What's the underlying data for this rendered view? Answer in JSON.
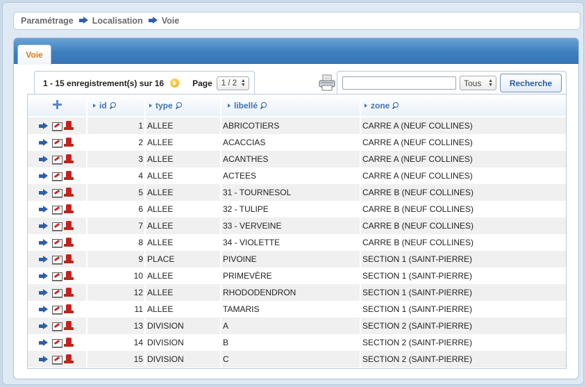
{
  "breadcrumb": {
    "items": [
      "Paramétrage",
      "Localisation",
      "Voie"
    ]
  },
  "tabs": [
    {
      "label": "Voie",
      "active": true
    }
  ],
  "pager": {
    "summary": "1 - 15 enregistrement(s) sur 16",
    "page_label": "Page",
    "page_value": "1 / 2"
  },
  "search": {
    "input_value": "",
    "scope_value": "Tous",
    "button_label": "Recherche"
  },
  "table": {
    "columns": [
      "id",
      "type",
      "libellé",
      "zone"
    ],
    "rows": [
      {
        "id": "1",
        "type": "ALLEE",
        "libelle": "ABRICOTIERS",
        "zone": "CARRE A (NEUF COLLINES)"
      },
      {
        "id": "2",
        "type": "ALLEE",
        "libelle": "ACACCIAS",
        "zone": "CARRE A (NEUF COLLINES)"
      },
      {
        "id": "3",
        "type": "ALLEE",
        "libelle": "ACANTHES",
        "zone": "CARRE A (NEUF COLLINES)"
      },
      {
        "id": "4",
        "type": "ALLEE",
        "libelle": "ACTEES",
        "zone": "CARRE A (NEUF COLLINES)"
      },
      {
        "id": "5",
        "type": "ALLEE",
        "libelle": "31 - TOURNESOL",
        "zone": "CARRE B (NEUF COLLINES)"
      },
      {
        "id": "6",
        "type": "ALLEE",
        "libelle": "32 - TULIPE",
        "zone": "CARRE B (NEUF COLLINES)"
      },
      {
        "id": "7",
        "type": "ALLEE",
        "libelle": "33 - VERVEINE",
        "zone": "CARRE B (NEUF COLLINES)"
      },
      {
        "id": "8",
        "type": "ALLEE",
        "libelle": "34 - VIOLETTE",
        "zone": "CARRE B (NEUF COLLINES)"
      },
      {
        "id": "9",
        "type": "PLACE",
        "libelle": "PIVOINE",
        "zone": "SECTION 1 (SAINT-PIERRE)"
      },
      {
        "id": "10",
        "type": "ALLEE",
        "libelle": "PRIMEVÈRE",
        "zone": "SECTION 1 (SAINT-PIERRE)"
      },
      {
        "id": "12",
        "type": "ALLEE",
        "libelle": "RHODODENDRON",
        "zone": "SECTION 1 (SAINT-PIERRE)"
      },
      {
        "id": "11",
        "type": "ALLEE",
        "libelle": "TAMARIS",
        "zone": "SECTION 1 (SAINT-PIERRE)"
      },
      {
        "id": "13",
        "type": "DIVISION",
        "libelle": "A",
        "zone": "SECTION 2 (SAINT-PIERRE)"
      },
      {
        "id": "14",
        "type": "DIVISION",
        "libelle": "B",
        "zone": "SECTION 2 (SAINT-PIERRE)"
      },
      {
        "id": "15",
        "type": "DIVISION",
        "libelle": "C",
        "zone": "SECTION 2 (SAINT-PIERRE)"
      }
    ]
  },
  "icons": {
    "breadcrumb_separator": "arrow-right-icon",
    "row_view": "arrow-right-icon",
    "row_edit": "edit-icon",
    "row_delete": "delete-icon",
    "add": "plus-icon",
    "next_page": "next-page-icon",
    "print": "printer-icon",
    "column_search": "magnifier-icon"
  },
  "colors": {
    "tab_accent": "#e27a12",
    "header_text": "#3f74b3",
    "tabbar": "#3e7fc0",
    "row_alt": "#f0f0f0"
  }
}
